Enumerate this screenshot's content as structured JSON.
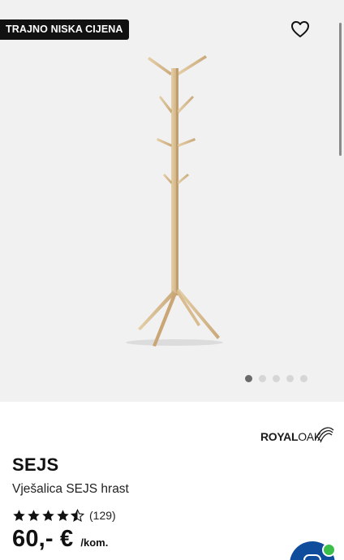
{
  "gallery": {
    "badge": "TRAJNO NISKA CIJENA",
    "wishlist_icon": "heart-outline-icon",
    "image_alt": "Vješalica SEJS hrast",
    "dots_total": 5,
    "active_index": 0
  },
  "brand": {
    "name_bold": "ROYAL",
    "name_light": "OAK",
    "logo_icon": "royal-oak-swoosh-logo"
  },
  "product": {
    "name": "SEJS",
    "description": "Vješalica SEJS hrast",
    "rating_value": 4.5,
    "rating_max": 5,
    "rating_count": "(129)",
    "price": "60,- €",
    "price_unit": "/kom."
  },
  "chat": {
    "icon": "chat-bubble-icon",
    "status_color": "#3cbf4a",
    "button_color": "#0f4c9c"
  }
}
